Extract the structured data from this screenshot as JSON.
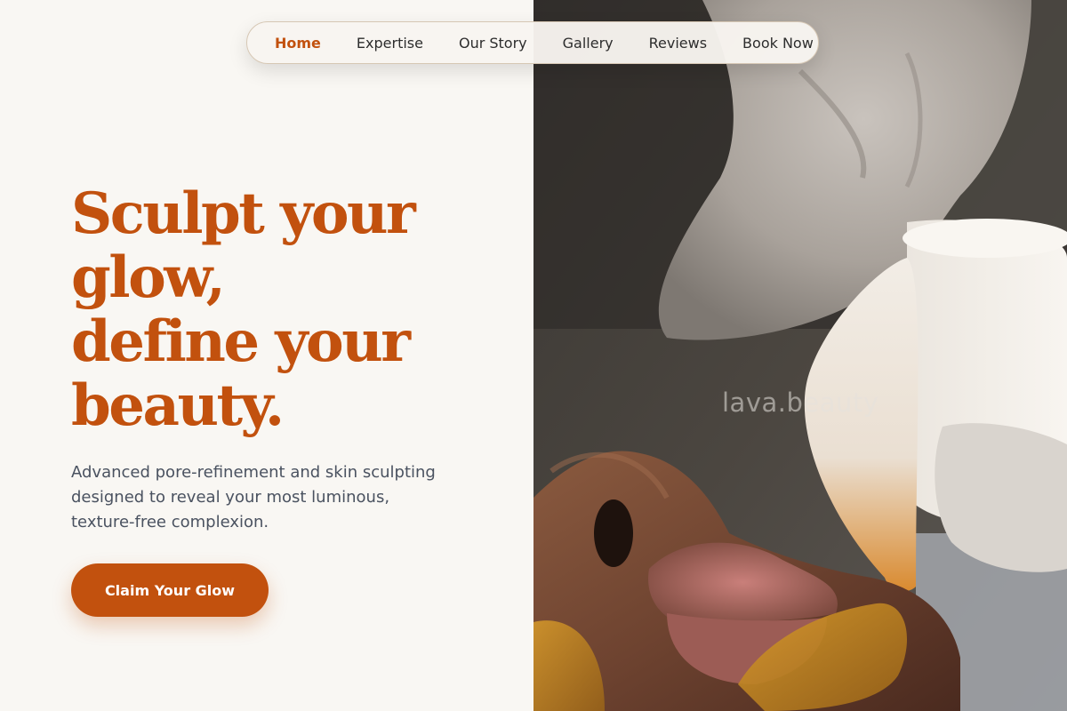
{
  "nav": {
    "items": [
      {
        "label": "Home",
        "active": true
      },
      {
        "label": "Expertise",
        "active": false
      },
      {
        "label": "Our Story",
        "active": false
      },
      {
        "label": "Gallery",
        "active": false
      },
      {
        "label": "Reviews",
        "active": false
      },
      {
        "label": "Book Now",
        "active": false
      }
    ]
  },
  "hero": {
    "headline_lines": [
      "Sculpt your",
      "glow,",
      "define your",
      "beauty."
    ],
    "subcopy_lines": [
      "Advanced pore-refinement and skin sculpting",
      "designed to reveal your most luminous,",
      "texture-free complexion."
    ],
    "cta_label": "Claim Your Glow"
  },
  "image": {
    "watermark": "lava.beauty"
  },
  "colors": {
    "accent": "#c2510e",
    "background": "#f9f7f3",
    "body_text": "#4a5260",
    "nav_text": "#2d2d2d"
  }
}
